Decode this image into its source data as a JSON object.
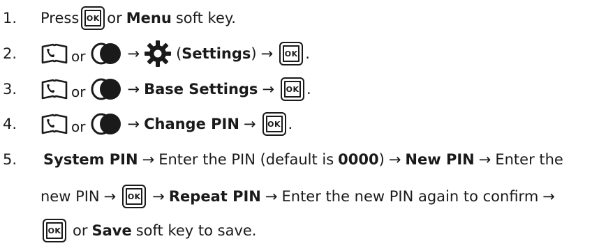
{
  "ok_key_label": "OK",
  "steps": [
    {
      "num": "1.",
      "press": "Press",
      "or": "or",
      "menu": "Menu",
      "soft_key": "soft key."
    },
    {
      "num": "2.",
      "or": "or",
      "arrow": "→",
      "settings_open": "(",
      "settings": "Settings",
      "settings_close": ")",
      "end": "."
    },
    {
      "num": "3.",
      "or": "or",
      "arrow": "→",
      "item": "Base Settings",
      "end": "."
    },
    {
      "num": "4.",
      "or": "or",
      "arrow": "→",
      "item": "Change PIN",
      "end": "."
    },
    {
      "num": "5.",
      "system_pin": "System PIN",
      "arrow": "→",
      "enter_pin": "Enter the PIN (default is",
      "default_pin": "0000",
      "close_paren": ")",
      "new_pin": "New PIN",
      "enter_the": "Enter the",
      "new_pin_lower": "new PIN",
      "repeat_pin": "Repeat PIN",
      "enter_again": "Enter the new PIN again to confirm",
      "or": "or",
      "save": "Save",
      "save_tail": "soft key to save."
    }
  ],
  "icons": [
    "phonebook-icon",
    "nav-key-icon",
    "gear-icon",
    "ok-key-icon"
  ]
}
